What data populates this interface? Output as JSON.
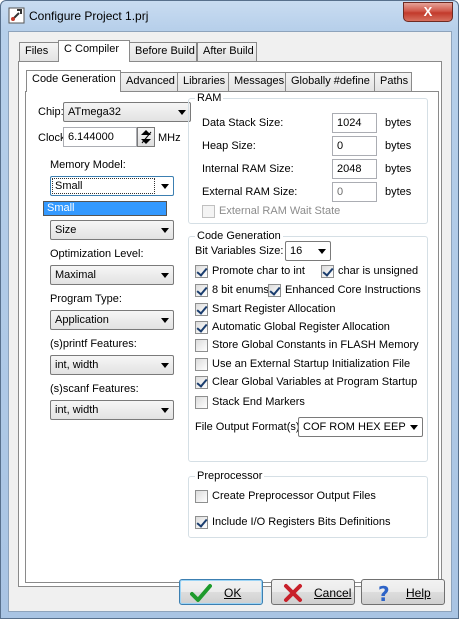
{
  "window": {
    "title": "Configure Project 1.prj",
    "close_glyph": "X",
    "accent_color": "#c23a2b"
  },
  "main_tabs": [
    {
      "label": "Files",
      "active": false
    },
    {
      "label": "C Compiler",
      "active": true
    },
    {
      "label": "Before Build",
      "active": false
    },
    {
      "label": "After Build",
      "active": false
    }
  ],
  "sub_tabs": [
    {
      "label": "Code Generation",
      "active": true
    },
    {
      "label": "Advanced",
      "active": false
    },
    {
      "label": "Libraries",
      "active": false
    },
    {
      "label": "Messages",
      "active": false
    },
    {
      "label": "Globally #define",
      "active": false
    },
    {
      "label": "Paths",
      "active": false
    }
  ],
  "left": {
    "chip_label": "Chip:",
    "chip_value": "ATmega32",
    "clock_label": "Clock:",
    "clock_value": "6.144000",
    "clock_unit": "MHz",
    "memory_model_label": "Memory Model:",
    "memory_model_value": "Small",
    "memory_model_dropdown_items": [
      "Small"
    ],
    "optimize_for_value": "Size",
    "optimization_level_label": "Optimization Level:",
    "optimization_level_value": "Maximal",
    "program_type_label": "Program Type:",
    "program_type_value": "Application",
    "printf_label": "(s)printf Features:",
    "printf_value": "int, width",
    "scanf_label": "(s)scanf Features:",
    "scanf_value": "int, width"
  },
  "ram": {
    "title": "RAM",
    "data_stack_label": "Data Stack Size:",
    "data_stack_value": "1024",
    "heap_label": "Heap Size:",
    "heap_value": "0",
    "internal_ram_label": "Internal RAM Size:",
    "internal_ram_value": "2048",
    "external_ram_label": "External RAM Size:",
    "external_ram_value": "0",
    "unit": "bytes",
    "wait_state_label": "External RAM Wait State",
    "wait_state_checked": false
  },
  "codegen": {
    "title": "Code Generation",
    "bit_vars_label": "Bit Variables Size:",
    "bit_vars_value": "16",
    "options": {
      "promote_char": {
        "label": "Promote char to int",
        "checked": true
      },
      "char_unsigned": {
        "label": "char is unsigned",
        "checked": true
      },
      "bit_enums": {
        "label": "8 bit enums",
        "checked": true
      },
      "enhanced_core": {
        "label": "Enhanced Core Instructions",
        "checked": true
      },
      "smart_reg": {
        "label": "Smart Register Allocation",
        "checked": true
      },
      "auto_global_reg": {
        "label": "Automatic Global Register Allocation",
        "checked": true
      },
      "store_flash": {
        "label": "Store Global Constants in FLASH Memory",
        "checked": false
      },
      "ext_startup": {
        "label": "Use an External Startup Initialization File",
        "checked": false
      },
      "clear_globals": {
        "label": "Clear Global Variables at Program Startup",
        "checked": true
      },
      "stack_end": {
        "label": "Stack End Markers",
        "checked": false
      }
    },
    "output_format_label": "File Output Format(s):",
    "output_format_value": "COF ROM HEX EEP"
  },
  "preprocessor": {
    "title": "Preprocessor",
    "create_output": {
      "label": "Create Preprocessor Output Files",
      "checked": false
    },
    "include_io": {
      "label": "Include I/O Registers Bits Definitions",
      "checked": true
    }
  },
  "buttons": {
    "ok": "OK",
    "cancel": "Cancel",
    "help": "Help"
  }
}
